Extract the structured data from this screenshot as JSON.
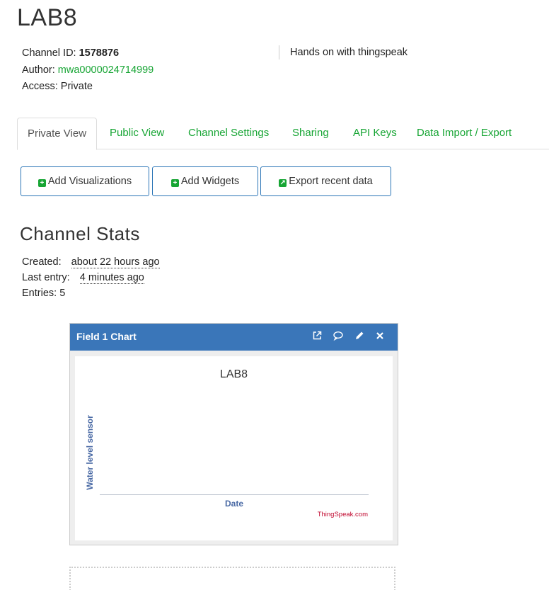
{
  "channel": {
    "name": "LAB8",
    "id_label": "Channel ID:",
    "id": "1578876",
    "author_label": "Author:",
    "author": "mwa0000024714999",
    "access_label": "Access:",
    "access": "Private",
    "description": "Hands on with thingspeak"
  },
  "tabs": [
    {
      "label": "Private View",
      "active": true
    },
    {
      "label": "Public View"
    },
    {
      "label": "Channel Settings"
    },
    {
      "label": "Sharing"
    },
    {
      "label": "API Keys"
    },
    {
      "label": "Data Import / Export"
    }
  ],
  "actions": {
    "add_visualizations": "Add Visualizations",
    "add_widgets": "Add Widgets",
    "export_recent": "Export recent data"
  },
  "stats": {
    "heading": "Channel Stats",
    "created_label": "Created:",
    "created": "about 22 hours ago",
    "last_entry_label": "Last entry:",
    "last_entry": "4 minutes ago",
    "entries_label": "Entries:",
    "entries": "5"
  },
  "widget": {
    "title": "Field 1 Chart",
    "icons": [
      "external-link-icon",
      "comment-icon",
      "pencil-icon",
      "close-icon"
    ],
    "header_color": "#3a76b9"
  },
  "chart_data": {
    "type": "line",
    "title": "LAB8",
    "xlabel": "Date",
    "ylabel": "Water level sensor",
    "series": [],
    "credit": "ThingSpeak.com"
  },
  "colors": {
    "accent_green": "#17a534",
    "button_border": "#2a74b6",
    "credit_red": "#c0062d"
  }
}
